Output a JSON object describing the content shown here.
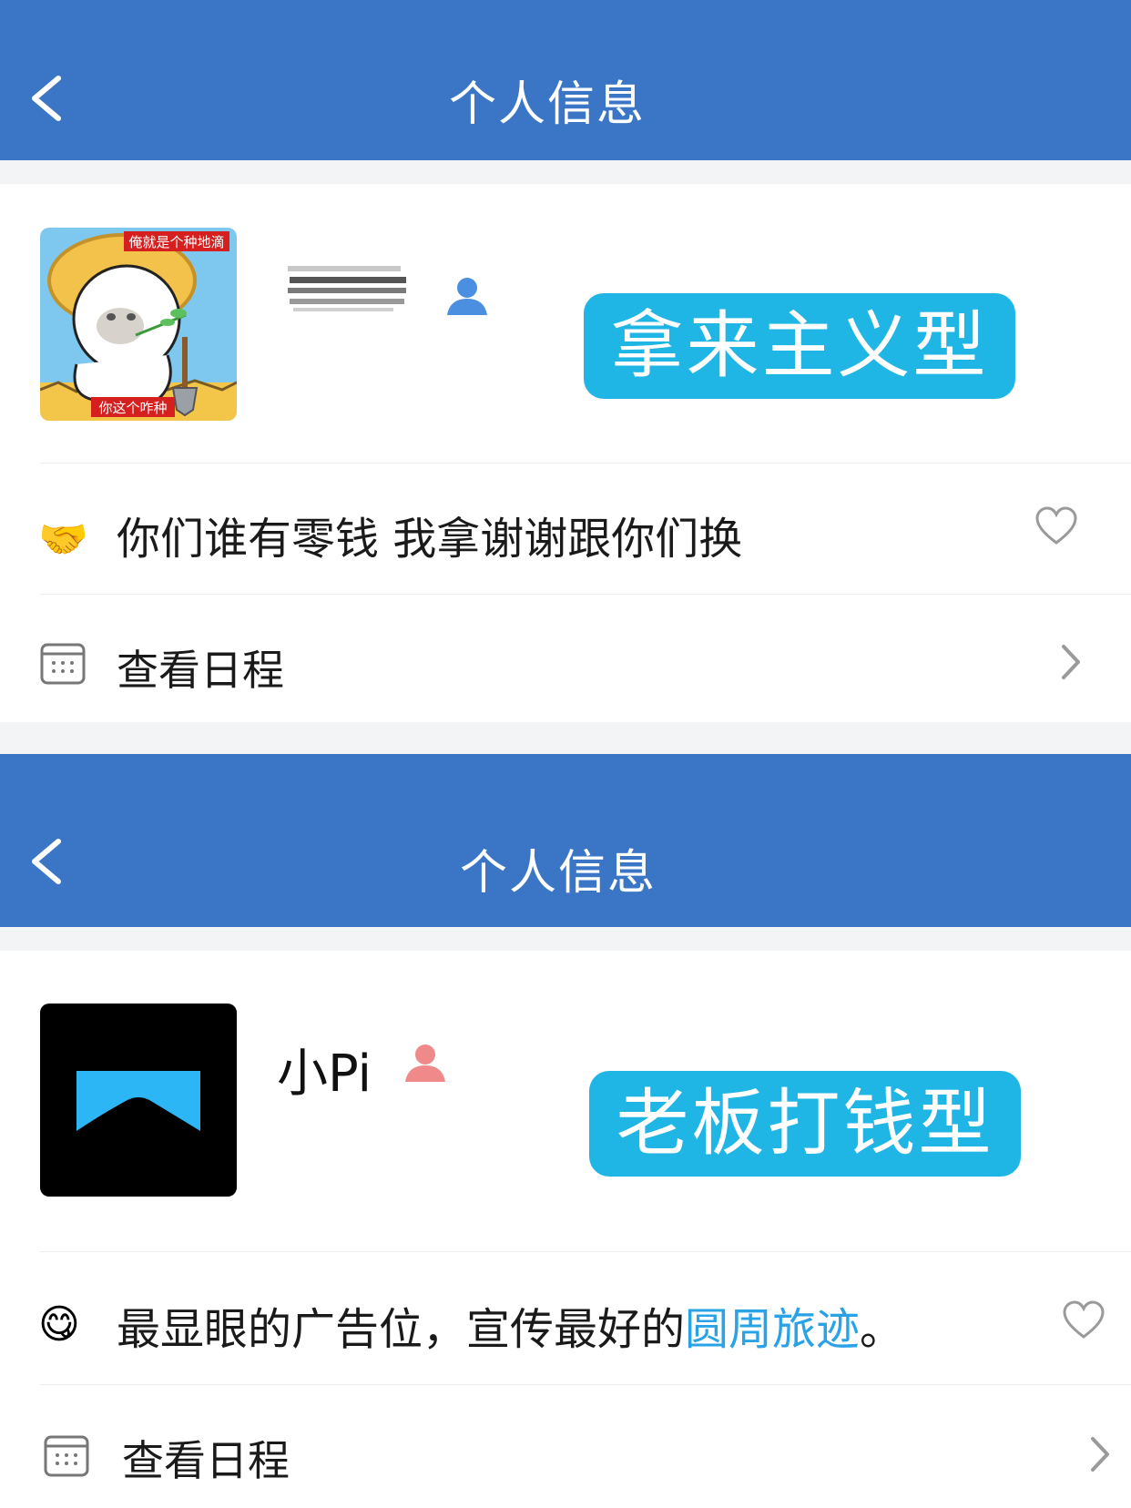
{
  "panel1": {
    "header_title": "个人信息",
    "avatar_caption_top": "俺就是个种地滴",
    "avatar_caption_bottom": "你这个咋种",
    "tag": "拿来主义型",
    "status_text": "你们谁有零钱 我拿谢谢跟你们换",
    "schedule_label": "查看日程",
    "status_emoji": "🤝"
  },
  "panel2": {
    "header_title": "个人信息",
    "username": "小Pi",
    "tag": "老板打钱型",
    "status_text_prefix": "最显眼的广告位，宣传最好的",
    "status_link": "圆周旅迹",
    "status_text_suffix": "。",
    "schedule_label": "查看日程",
    "status_emoji": "😋"
  },
  "colors": {
    "header": "#3b76c6",
    "tag": "#1fb6e6",
    "link": "#29a3e6",
    "user_icon_panel1": "#4a8fe0",
    "user_icon_panel2": "#f08a8a"
  },
  "icons": [
    "back-icon",
    "user-icon",
    "handshake-emoji",
    "heart-icon",
    "calendar-icon",
    "chevron-right-icon",
    "smile-emoji"
  ]
}
